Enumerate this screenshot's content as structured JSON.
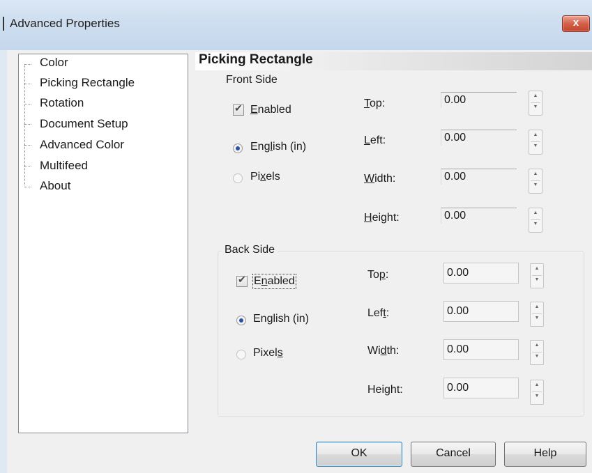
{
  "window": {
    "title": "Advanced Properties",
    "close_glyph": "x"
  },
  "tree": {
    "items": [
      {
        "label": "Color"
      },
      {
        "label": "Picking Rectangle"
      },
      {
        "label": "Rotation"
      },
      {
        "label": "Document Setup"
      },
      {
        "label": "Advanced Color"
      },
      {
        "label": "Multifeed"
      },
      {
        "label": "About"
      }
    ]
  },
  "panel": {
    "title": "Picking Rectangle"
  },
  "front": {
    "group_label": "Front Side",
    "enabled": {
      "pre": "",
      "mnemonic": "E",
      "post": "nabled",
      "checked": true
    },
    "english": {
      "pre": "Eng",
      "mnemonic": "l",
      "post": "ish (in)",
      "selected": true
    },
    "pixels": {
      "pre": "Pi",
      "mnemonic": "x",
      "post": "els",
      "selected": false
    },
    "top": {
      "pre": "",
      "mnemonic": "T",
      "post": "op:",
      "value": "0.00"
    },
    "left": {
      "pre": "",
      "mnemonic": "L",
      "post": "eft:",
      "value": "0.00"
    },
    "width": {
      "pre": "",
      "mnemonic": "W",
      "post": "idth:",
      "value": "0.00"
    },
    "height": {
      "pre": "",
      "mnemonic": "H",
      "post": "eight:",
      "value": "0.00"
    }
  },
  "back": {
    "group_label": "Back Side",
    "enabled": {
      "pre": "E",
      "mnemonic": "n",
      "post": "abled",
      "checked": true
    },
    "english": {
      "pre": "English (in)",
      "mnemonic": "",
      "post": "",
      "selected": true
    },
    "pixels": {
      "pre": "Pixel",
      "mnemonic": "s",
      "post": "",
      "selected": false
    },
    "top": {
      "pre": "To",
      "mnemonic": "p",
      "post": ":",
      "value": "0.00"
    },
    "left": {
      "pre": "Lef",
      "mnemonic": "t",
      "post": ":",
      "value": "0.00"
    },
    "width": {
      "pre": "Wi",
      "mnemonic": "d",
      "post": "th:",
      "value": "0.00"
    },
    "height": {
      "pre": "Hei",
      "mnemonic": "g",
      "post": "ht:",
      "value": "0.00"
    }
  },
  "buttons": {
    "ok": "OK",
    "cancel": "Cancel",
    "help": "Help"
  },
  "colors": {
    "title_bg": "#cfdff0",
    "close_red": "#c2452e",
    "radio_dot": "#2a4fa8",
    "client_bg": "#f0f0f0"
  }
}
